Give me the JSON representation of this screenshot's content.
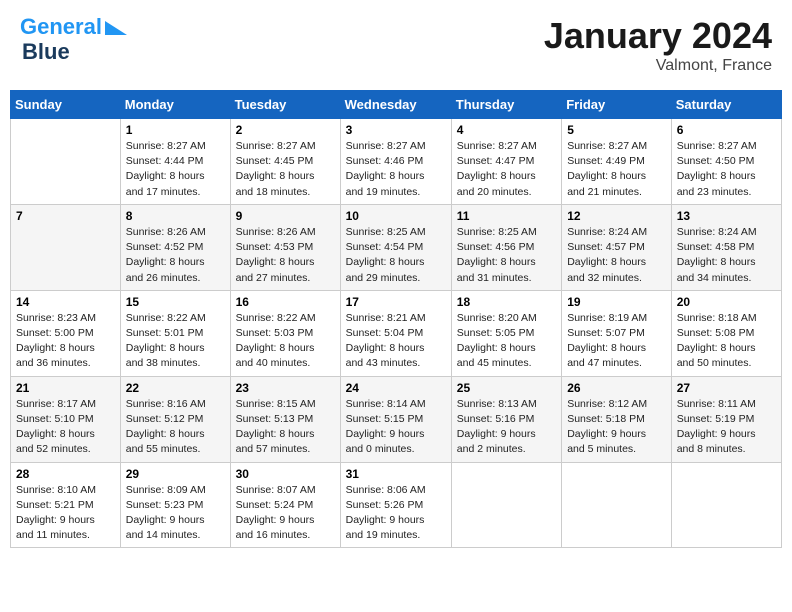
{
  "header": {
    "logo_line1": "General",
    "logo_line2": "Blue",
    "title": "January 2024",
    "location": "Valmont, France"
  },
  "weekdays": [
    "Sunday",
    "Monday",
    "Tuesday",
    "Wednesday",
    "Thursday",
    "Friday",
    "Saturday"
  ],
  "weeks": [
    [
      {
        "day": "",
        "info": ""
      },
      {
        "day": "1",
        "info": "Sunrise: 8:27 AM\nSunset: 4:44 PM\nDaylight: 8 hours\nand 17 minutes."
      },
      {
        "day": "2",
        "info": "Sunrise: 8:27 AM\nSunset: 4:45 PM\nDaylight: 8 hours\nand 18 minutes."
      },
      {
        "day": "3",
        "info": "Sunrise: 8:27 AM\nSunset: 4:46 PM\nDaylight: 8 hours\nand 19 minutes."
      },
      {
        "day": "4",
        "info": "Sunrise: 8:27 AM\nSunset: 4:47 PM\nDaylight: 8 hours\nand 20 minutes."
      },
      {
        "day": "5",
        "info": "Sunrise: 8:27 AM\nSunset: 4:49 PM\nDaylight: 8 hours\nand 21 minutes."
      },
      {
        "day": "6",
        "info": "Sunrise: 8:27 AM\nSunset: 4:50 PM\nDaylight: 8 hours\nand 23 minutes."
      }
    ],
    [
      {
        "day": "7",
        "info": ""
      },
      {
        "day": "8",
        "info": "Sunrise: 8:26 AM\nSunset: 4:52 PM\nDaylight: 8 hours\nand 26 minutes."
      },
      {
        "day": "9",
        "info": "Sunrise: 8:26 AM\nSunset: 4:53 PM\nDaylight: 8 hours\nand 27 minutes."
      },
      {
        "day": "10",
        "info": "Sunrise: 8:25 AM\nSunset: 4:54 PM\nDaylight: 8 hours\nand 29 minutes."
      },
      {
        "day": "11",
        "info": "Sunrise: 8:25 AM\nSunset: 4:56 PM\nDaylight: 8 hours\nand 31 minutes."
      },
      {
        "day": "12",
        "info": "Sunrise: 8:24 AM\nSunset: 4:57 PM\nDaylight: 8 hours\nand 32 minutes."
      },
      {
        "day": "13",
        "info": "Sunrise: 8:24 AM\nSunset: 4:58 PM\nDaylight: 8 hours\nand 34 minutes."
      }
    ],
    [
      {
        "day": "14",
        "info": "Sunrise: 8:23 AM\nSunset: 5:00 PM\nDaylight: 8 hours\nand 36 minutes."
      },
      {
        "day": "15",
        "info": "Sunrise: 8:22 AM\nSunset: 5:01 PM\nDaylight: 8 hours\nand 38 minutes."
      },
      {
        "day": "16",
        "info": "Sunrise: 8:22 AM\nSunset: 5:03 PM\nDaylight: 8 hours\nand 40 minutes."
      },
      {
        "day": "17",
        "info": "Sunrise: 8:21 AM\nSunset: 5:04 PM\nDaylight: 8 hours\nand 43 minutes."
      },
      {
        "day": "18",
        "info": "Sunrise: 8:20 AM\nSunset: 5:05 PM\nDaylight: 8 hours\nand 45 minutes."
      },
      {
        "day": "19",
        "info": "Sunrise: 8:19 AM\nSunset: 5:07 PM\nDaylight: 8 hours\nand 47 minutes."
      },
      {
        "day": "20",
        "info": "Sunrise: 8:18 AM\nSunset: 5:08 PM\nDaylight: 8 hours\nand 50 minutes."
      }
    ],
    [
      {
        "day": "21",
        "info": "Sunrise: 8:17 AM\nSunset: 5:10 PM\nDaylight: 8 hours\nand 52 minutes."
      },
      {
        "day": "22",
        "info": "Sunrise: 8:16 AM\nSunset: 5:12 PM\nDaylight: 8 hours\nand 55 minutes."
      },
      {
        "day": "23",
        "info": "Sunrise: 8:15 AM\nSunset: 5:13 PM\nDaylight: 8 hours\nand 57 minutes."
      },
      {
        "day": "24",
        "info": "Sunrise: 8:14 AM\nSunset: 5:15 PM\nDaylight: 9 hours\nand 0 minutes."
      },
      {
        "day": "25",
        "info": "Sunrise: 8:13 AM\nSunset: 5:16 PM\nDaylight: 9 hours\nand 2 minutes."
      },
      {
        "day": "26",
        "info": "Sunrise: 8:12 AM\nSunset: 5:18 PM\nDaylight: 9 hours\nand 5 minutes."
      },
      {
        "day": "27",
        "info": "Sunrise: 8:11 AM\nSunset: 5:19 PM\nDaylight: 9 hours\nand 8 minutes."
      }
    ],
    [
      {
        "day": "28",
        "info": "Sunrise: 8:10 AM\nSunset: 5:21 PM\nDaylight: 9 hours\nand 11 minutes."
      },
      {
        "day": "29",
        "info": "Sunrise: 8:09 AM\nSunset: 5:23 PM\nDaylight: 9 hours\nand 14 minutes."
      },
      {
        "day": "30",
        "info": "Sunrise: 8:07 AM\nSunset: 5:24 PM\nDaylight: 9 hours\nand 16 minutes."
      },
      {
        "day": "31",
        "info": "Sunrise: 8:06 AM\nSunset: 5:26 PM\nDaylight: 9 hours\nand 19 minutes."
      },
      {
        "day": "",
        "info": ""
      },
      {
        "day": "",
        "info": ""
      },
      {
        "day": "",
        "info": ""
      }
    ]
  ]
}
